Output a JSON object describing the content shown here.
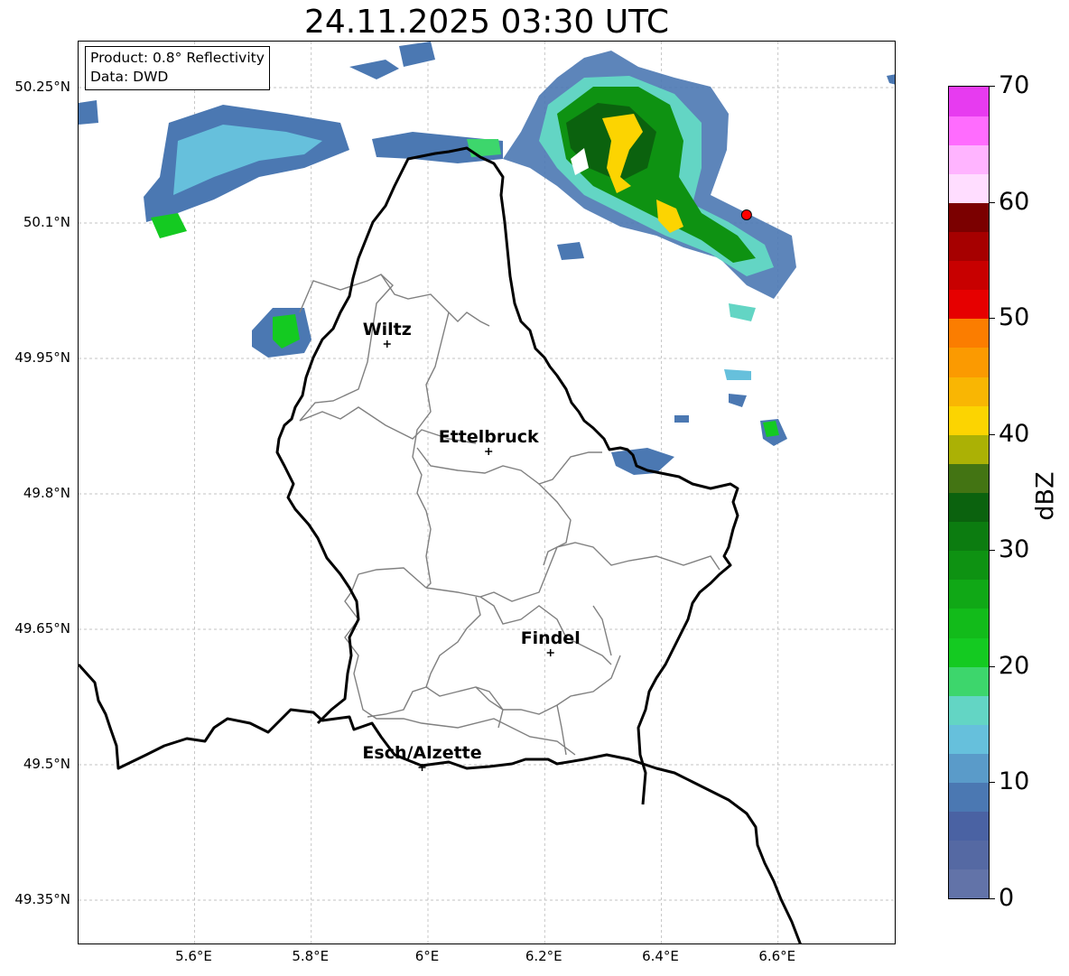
{
  "title": "24.11.2025 03:30 UTC",
  "info": {
    "product": "Product: 0.8° Reflectivity",
    "data": "Data: DWD"
  },
  "lat_ticks": [
    {
      "value": 50.25,
      "label": "50.25°N"
    },
    {
      "value": 50.1,
      "label": "50.1°N"
    },
    {
      "value": 49.95,
      "label": "49.95°N"
    },
    {
      "value": 49.8,
      "label": "49.8°N"
    },
    {
      "value": 49.65,
      "label": "49.65°N"
    },
    {
      "value": 49.5,
      "label": "49.5°N"
    },
    {
      "value": 49.35,
      "label": "49.35°N"
    }
  ],
  "lon_ticks": [
    {
      "value": 5.6,
      "label": "5.6°E"
    },
    {
      "value": 5.8,
      "label": "5.8°E"
    },
    {
      "value": 6.0,
      "label": "6°E"
    },
    {
      "value": 6.2,
      "label": "6.2°E"
    },
    {
      "value": 6.4,
      "label": "6.4°E"
    },
    {
      "value": 6.6,
      "label": "6.6°E"
    }
  ],
  "cities": [
    {
      "name": "Wiltz",
      "lon": 5.93,
      "lat": 49.966
    },
    {
      "name": "Ettelbruck",
      "lon": 6.104,
      "lat": 49.847
    },
    {
      "name": "Findel",
      "lon": 6.21,
      "lat": 49.624
    },
    {
      "name": "Esch/Alzette",
      "lon": 5.99,
      "lat": 49.497
    }
  ],
  "marker": {
    "lon": 6.546,
    "lat": 50.109,
    "color": "#ff0000"
  },
  "colorbar": {
    "label": "dBZ",
    "min": 0,
    "max": 70,
    "ticks": [
      "0",
      "10",
      "20",
      "30",
      "40",
      "50",
      "60",
      "70"
    ],
    "colors": [
      "#6273a8",
      "#5569a3",
      "#4a62a3",
      "#4b78b2",
      "#5a9bc9",
      "#66c0dc",
      "#63d5c4",
      "#3dd66c",
      "#14ca21",
      "#12bb1a",
      "#10a816",
      "#0e9212",
      "#0c7c10",
      "#0b620e",
      "#437413",
      "#abb105",
      "#fcd401",
      "#f9b603",
      "#fb9a01",
      "#fb7d00",
      "#e60000",
      "#c80000",
      "#a60000",
      "#7b0000",
      "#ffddff",
      "#ffb4ff",
      "#ff6cfe",
      "#e73bf0"
    ]
  },
  "colors": {
    "border": "#000000",
    "cantons": "#808080",
    "grid": "#b0b0b0"
  }
}
